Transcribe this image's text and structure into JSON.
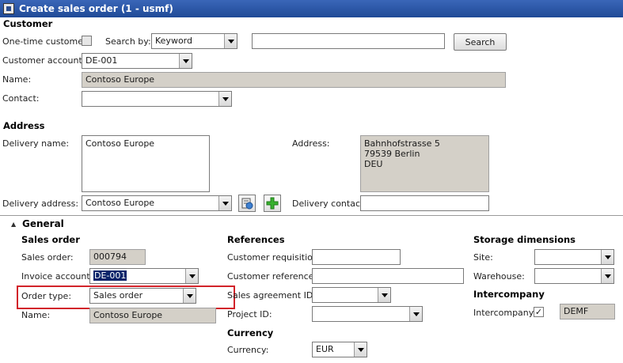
{
  "window": {
    "title": "Create sales order (1 - usmf)"
  },
  "customer": {
    "heading": "Customer",
    "one_time_label": "One-time customer:",
    "search_by_label": "Search by:",
    "search_by_value": "Keyword",
    "search_text": "",
    "search_button": "Search",
    "account_label": "Customer account:",
    "account_value": "DE-001",
    "name_label": "Name:",
    "name_value": "Contoso Europe",
    "contact_label": "Contact:",
    "contact_value": ""
  },
  "address": {
    "heading": "Address",
    "delivery_name_label": "Delivery name:",
    "delivery_name_value": "Contoso Europe",
    "address_label": "Address:",
    "address_lines": [
      "Bahnhofstrasse 5",
      "79539 Berlin",
      "DEU"
    ],
    "delivery_address_label": "Delivery address:",
    "delivery_address_value": "Contoso Europe",
    "delivery_contact_label": "Delivery contact:",
    "delivery_contact_value": ""
  },
  "general": {
    "heading": "General",
    "sales_order_group": {
      "heading": "Sales order",
      "sales_order_label": "Sales order:",
      "sales_order_value": "000794",
      "invoice_account_label": "Invoice account:",
      "invoice_account_value": "DE-001",
      "order_type_label": "Order type:",
      "order_type_value": "Sales order",
      "name_label": "Name:",
      "name_value": "Contoso Europe"
    },
    "references": {
      "heading": "References",
      "customer_requisition_label": "Customer requisition:",
      "customer_requisition_value": "",
      "customer_reference_label": "Customer reference:",
      "customer_reference_value": "",
      "sales_agreement_label": "Sales agreement ID:",
      "sales_agreement_value": "",
      "project_id_label": "Project ID:",
      "project_id_value": ""
    },
    "currency": {
      "heading": "Currency",
      "currency_label": "Currency:",
      "currency_value": "EUR"
    },
    "storage": {
      "heading": "Storage dimensions",
      "site_label": "Site:",
      "site_value": "",
      "warehouse_label": "Warehouse:",
      "warehouse_value": ""
    },
    "intercompany": {
      "heading": "Intercompany",
      "intercompany_label": "Intercompany:",
      "intercompany_checked": "✓",
      "company_value": "DEMF"
    }
  },
  "colors": {
    "titlebar": "#1f4a97",
    "readonly": "#d4d0c8",
    "highlight": "#d2232a"
  }
}
